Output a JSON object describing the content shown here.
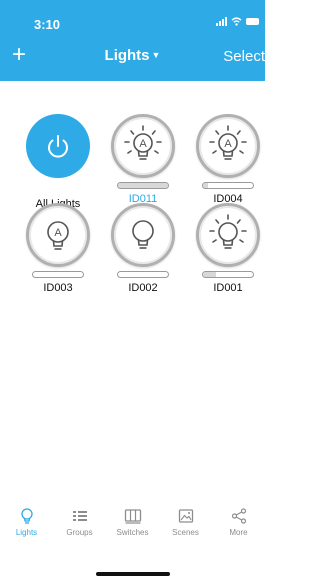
{
  "status": {
    "time": "3:10"
  },
  "header": {
    "add_label": "+",
    "title": "Lights",
    "select_label": "Select"
  },
  "tiles": [
    {
      "label": "All Lights",
      "kind": "power",
      "selected": false
    },
    {
      "label": "ID011",
      "kind": "bulb-a",
      "selected": true,
      "level": 1.0
    },
    {
      "label": "ID004",
      "kind": "bulb-a",
      "selected": false,
      "level": 0.1
    },
    {
      "label": "ID003",
      "kind": "bulb-a-off",
      "selected": false,
      "level": 0.0
    },
    {
      "label": "ID002",
      "kind": "bulb-off",
      "selected": false,
      "level": 0.0
    },
    {
      "label": "ID001",
      "kind": "bulb-rays",
      "selected": false,
      "level": 0.25
    }
  ],
  "tabs": [
    {
      "label": "Lights",
      "icon": "bulb-icon",
      "active": true
    },
    {
      "label": "Groups",
      "icon": "groups-icon",
      "active": false
    },
    {
      "label": "Switches",
      "icon": "switches-icon",
      "active": false
    },
    {
      "label": "Scenes",
      "icon": "scenes-icon",
      "active": false
    },
    {
      "label": "More",
      "icon": "share-icon",
      "active": false
    }
  ],
  "colors": {
    "accent": "#2eaae6",
    "inactive": "#8d8d8d"
  }
}
